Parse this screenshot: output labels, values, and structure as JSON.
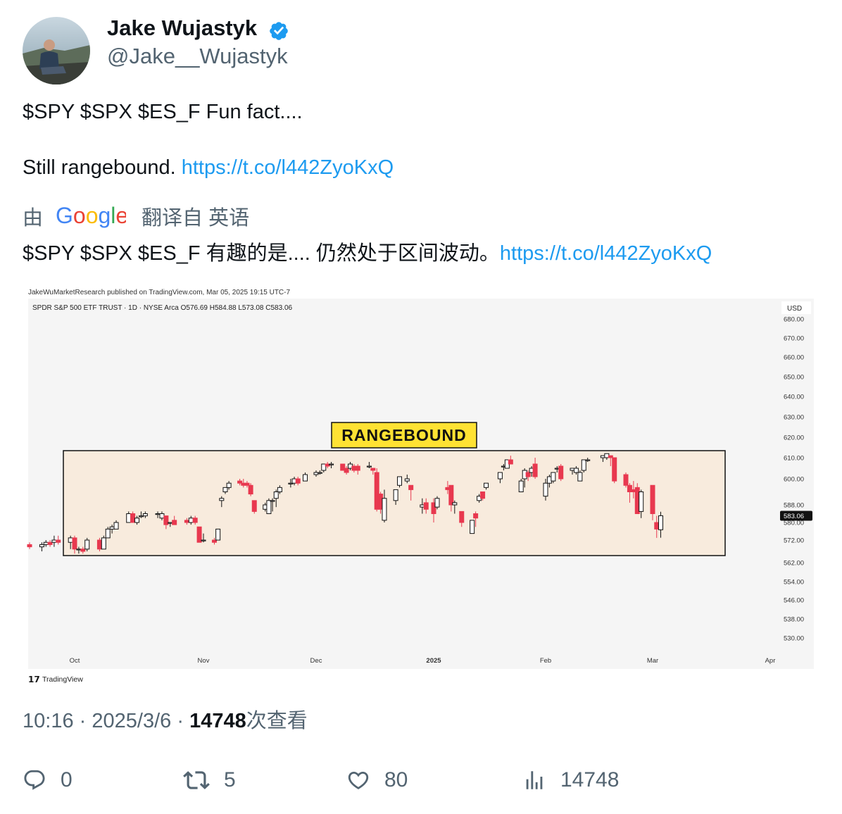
{
  "author": {
    "name": "Jake Wujastyk",
    "handle": "@Jake__Wujastyk"
  },
  "tweet": {
    "line1": "$SPY $SPX $ES_F Fun fact....",
    "line2_text": "Still rangebound. ",
    "link": "https://t.co/l442ZyoKxQ",
    "translated_by_prefix": "由",
    "translated_by_suffix": "翻译自 英语",
    "translation_text": "$SPY $SPX $ES_F 有趣的是.... 仍然处于区间波动。",
    "translation_link": "https://t.co/l442ZyoKxQ"
  },
  "chart": {
    "publisher_line": "JakeWuMarketResearch published on TradingView.com, Mar 05, 2025 19:15 UTC-7",
    "symbol_line": "SPDR S&P 500 ETF TRUST · 1D · NYSE Arca  O576.69  H584.88  L573.08  C583.06",
    "currency": "USD",
    "price_ticks": [
      "680.00",
      "670.00",
      "660.00",
      "650.00",
      "640.00",
      "630.00",
      "620.00",
      "610.00",
      "600.00",
      "588.00",
      "580.00",
      "572.00",
      "562.00",
      "554.00",
      "546.00",
      "538.00",
      "530.00"
    ],
    "last_price": "583.06",
    "month_labels": [
      "Oct",
      "Nov",
      "Dec",
      "2025",
      "Feb",
      "Mar",
      "Apr"
    ],
    "annotation": "RANGEBOUND",
    "watermark": "TradingView",
    "up_color": "#111111",
    "down_color": "#e8384f",
    "box_fill": "#f8ebdd",
    "label_fill": "#ffe233",
    "candles": [
      {
        "d": "2024-09-20",
        "o": 570,
        "h": 571,
        "l": 568,
        "c": 569
      },
      {
        "d": "2024-09-23",
        "o": 569,
        "h": 571,
        "l": 567,
        "c": 570
      },
      {
        "d": "2024-09-24",
        "o": 570,
        "h": 572,
        "l": 569,
        "c": 571
      },
      {
        "d": "2024-09-25",
        "o": 571,
        "h": 572,
        "l": 569,
        "c": 570
      },
      {
        "d": "2024-09-26",
        "o": 571,
        "h": 574,
        "l": 569,
        "c": 572
      },
      {
        "d": "2024-09-27",
        "o": 572,
        "h": 574,
        "l": 570,
        "c": 571
      },
      {
        "d": "2024-09-30",
        "o": 571,
        "h": 574,
        "l": 568,
        "c": 573
      },
      {
        "d": "2024-10-01",
        "o": 573,
        "h": 574,
        "l": 566,
        "c": 568
      },
      {
        "d": "2024-10-02",
        "o": 568,
        "h": 569,
        "l": 566,
        "c": 568
      },
      {
        "d": "2024-10-03",
        "o": 568,
        "h": 569,
        "l": 566,
        "c": 567
      },
      {
        "d": "2024-10-04",
        "o": 568,
        "h": 573,
        "l": 567,
        "c": 572
      },
      {
        "d": "2024-10-07",
        "o": 572,
        "h": 573,
        "l": 567,
        "c": 568
      },
      {
        "d": "2024-10-08",
        "o": 568,
        "h": 574,
        "l": 568,
        "c": 573
      },
      {
        "d": "2024-10-09",
        "o": 573,
        "h": 578,
        "l": 573,
        "c": 577
      },
      {
        "d": "2024-10-10",
        "o": 577,
        "h": 579,
        "l": 575,
        "c": 578
      },
      {
        "d": "2024-10-11",
        "o": 577,
        "h": 581,
        "l": 577,
        "c": 580
      },
      {
        "d": "2024-10-14",
        "o": 580,
        "h": 585,
        "l": 580,
        "c": 584
      },
      {
        "d": "2024-10-15",
        "o": 584,
        "h": 585,
        "l": 580,
        "c": 580
      },
      {
        "d": "2024-10-16",
        "o": 580,
        "h": 583,
        "l": 579,
        "c": 582
      },
      {
        "d": "2024-10-17",
        "o": 583,
        "h": 585,
        "l": 582,
        "c": 583
      },
      {
        "d": "2024-10-18",
        "o": 583,
        "h": 585,
        "l": 582,
        "c": 584
      },
      {
        "d": "2024-10-21",
        "o": 584,
        "h": 585,
        "l": 582,
        "c": 584
      },
      {
        "d": "2024-10-22",
        "o": 582,
        "h": 585,
        "l": 581,
        "c": 584
      },
      {
        "d": "2024-10-23",
        "o": 583,
        "h": 583,
        "l": 577,
        "c": 579
      },
      {
        "d": "2024-10-24",
        "o": 580,
        "h": 580,
        "l": 578,
        "c": 580
      },
      {
        "d": "2024-10-25",
        "o": 581,
        "h": 583,
        "l": 579,
        "c": 579
      },
      {
        "d": "2024-10-28",
        "o": 581,
        "h": 582,
        "l": 579,
        "c": 580
      },
      {
        "d": "2024-10-29",
        "o": 580,
        "h": 583,
        "l": 579,
        "c": 582
      },
      {
        "d": "2024-10-30",
        "o": 582,
        "h": 583,
        "l": 579,
        "c": 580
      },
      {
        "d": "2024-10-31",
        "o": 578,
        "h": 578,
        "l": 571,
        "c": 571
      },
      {
        "d": "2024-11-01",
        "o": 572,
        "h": 575,
        "l": 571,
        "c": 572
      },
      {
        "d": "2024-11-04",
        "o": 572,
        "h": 573,
        "l": 570,
        "c": 571
      },
      {
        "d": "2024-11-05",
        "o": 572,
        "h": 577,
        "l": 572,
        "c": 577
      },
      {
        "d": "2024-11-06",
        "o": 590,
        "h": 592,
        "l": 587,
        "c": 591
      },
      {
        "d": "2024-11-07",
        "o": 594,
        "h": 596,
        "l": 593,
        "c": 596
      },
      {
        "d": "2024-11-08",
        "o": 596,
        "h": 599,
        "l": 595,
        "c": 598
      },
      {
        "d": "2024-11-11",
        "o": 599,
        "h": 600,
        "l": 597,
        "c": 598
      },
      {
        "d": "2024-11-12",
        "o": 598,
        "h": 600,
        "l": 596,
        "c": 597
      },
      {
        "d": "2024-11-13",
        "o": 598,
        "h": 599,
        "l": 596,
        "c": 597
      },
      {
        "d": "2024-11-14",
        "o": 597,
        "h": 598,
        "l": 592,
        "c": 593
      },
      {
        "d": "2024-11-15",
        "o": 590,
        "h": 590,
        "l": 584,
        "c": 585
      },
      {
        "d": "2024-11-18",
        "o": 586,
        "h": 589,
        "l": 585,
        "c": 588
      },
      {
        "d": "2024-11-19",
        "o": 584,
        "h": 591,
        "l": 584,
        "c": 590
      },
      {
        "d": "2024-11-20",
        "o": 590,
        "h": 591,
        "l": 585,
        "c": 590
      },
      {
        "d": "2024-11-21",
        "o": 591,
        "h": 595,
        "l": 587,
        "c": 594
      },
      {
        "d": "2024-11-22",
        "o": 594,
        "h": 597,
        "l": 593,
        "c": 596
      },
      {
        "d": "2024-11-25",
        "o": 598,
        "h": 600,
        "l": 596,
        "c": 598
      },
      {
        "d": "2024-11-26",
        "o": 598,
        "h": 601,
        "l": 597,
        "c": 600
      },
      {
        "d": "2024-11-27",
        "o": 600,
        "h": 601,
        "l": 597,
        "c": 598
      },
      {
        "d": "2024-11-29",
        "o": 599,
        "h": 603,
        "l": 599,
        "c": 602
      },
      {
        "d": "2024-12-02",
        "o": 602,
        "h": 604,
        "l": 601,
        "c": 603
      },
      {
        "d": "2024-12-03",
        "o": 603,
        "h": 604,
        "l": 602,
        "c": 603
      },
      {
        "d": "2024-12-04",
        "o": 604,
        "h": 607,
        "l": 603,
        "c": 607
      },
      {
        "d": "2024-12-05",
        "o": 607,
        "h": 608,
        "l": 605,
        "c": 606
      },
      {
        "d": "2024-12-06",
        "o": 607,
        "h": 608,
        "l": 605,
        "c": 607
      },
      {
        "d": "2024-12-09",
        "o": 607,
        "h": 607,
        "l": 604,
        "c": 604
      },
      {
        "d": "2024-12-10",
        "o": 605,
        "h": 606,
        "l": 602,
        "c": 603
      },
      {
        "d": "2024-12-11",
        "o": 605,
        "h": 608,
        "l": 604,
        "c": 607
      },
      {
        "d": "2024-12-12",
        "o": 606,
        "h": 607,
        "l": 603,
        "c": 604
      },
      {
        "d": "2024-12-13",
        "o": 606,
        "h": 607,
        "l": 602,
        "c": 604
      },
      {
        "d": "2024-12-16",
        "o": 606,
        "h": 608,
        "l": 605,
        "c": 606
      },
      {
        "d": "2024-12-17",
        "o": 605,
        "h": 605,
        "l": 602,
        "c": 604
      },
      {
        "d": "2024-12-18",
        "o": 603,
        "h": 605,
        "l": 585,
        "c": 586
      },
      {
        "d": "2024-12-19",
        "o": 593,
        "h": 594,
        "l": 584,
        "c": 586
      },
      {
        "d": "2024-12-20",
        "o": 581,
        "h": 595,
        "l": 580,
        "c": 591
      },
      {
        "d": "2024-12-23",
        "o": 590,
        "h": 595,
        "l": 588,
        "c": 595
      },
      {
        "d": "2024-12-24",
        "o": 597,
        "h": 601,
        "l": 596,
        "c": 601
      },
      {
        "d": "2024-12-26",
        "o": 599,
        "h": 602,
        "l": 598,
        "c": 600
      },
      {
        "d": "2024-12-27",
        "o": 597,
        "h": 597,
        "l": 590,
        "c": 595
      },
      {
        "d": "2024-12-30",
        "o": 587,
        "h": 591,
        "l": 584,
        "c": 588
      },
      {
        "d": "2024-12-31",
        "o": 589,
        "h": 591,
        "l": 584,
        "c": 586
      },
      {
        "d": "2025-01-02",
        "o": 589,
        "h": 591,
        "l": 580,
        "c": 584
      },
      {
        "d": "2025-01-03",
        "o": 587,
        "h": 592,
        "l": 586,
        "c": 591
      },
      {
        "d": "2025-01-06",
        "o": 596,
        "h": 599,
        "l": 593,
        "c": 595
      },
      {
        "d": "2025-01-07",
        "o": 597,
        "h": 597,
        "l": 585,
        "c": 588
      },
      {
        "d": "2025-01-08",
        "o": 588,
        "h": 590,
        "l": 584,
        "c": 589
      },
      {
        "d": "2025-01-10",
        "o": 585,
        "h": 585,
        "l": 578,
        "c": 580
      },
      {
        "d": "2025-01-13",
        "o": 575,
        "h": 581,
        "l": 575,
        "c": 581
      },
      {
        "d": "2025-01-14",
        "o": 584,
        "h": 585,
        "l": 578,
        "c": 582
      },
      {
        "d": "2025-01-15",
        "o": 590,
        "h": 593,
        "l": 589,
        "c": 592
      },
      {
        "d": "2025-01-16",
        "o": 594,
        "h": 594,
        "l": 590,
        "c": 591
      },
      {
        "d": "2025-01-17",
        "o": 596,
        "h": 598,
        "l": 595,
        "c": 598
      },
      {
        "d": "2025-01-21",
        "o": 600,
        "h": 603,
        "l": 598,
        "c": 603
      },
      {
        "d": "2025-01-22",
        "o": 606,
        "h": 607,
        "l": 604,
        "c": 606
      },
      {
        "d": "2025-01-23",
        "o": 605,
        "h": 609,
        "l": 605,
        "c": 609
      },
      {
        "d": "2025-01-24",
        "o": 609,
        "h": 611,
        "l": 607,
        "c": 607
      },
      {
        "d": "2025-01-27",
        "o": 594,
        "h": 600,
        "l": 594,
        "c": 599
      },
      {
        "d": "2025-01-28",
        "o": 600,
        "h": 605,
        "l": 596,
        "c": 604
      },
      {
        "d": "2025-01-29",
        "o": 603,
        "h": 604,
        "l": 599,
        "c": 601
      },
      {
        "d": "2025-01-30",
        "o": 603,
        "h": 606,
        "l": 601,
        "c": 605
      },
      {
        "d": "2025-01-31",
        "o": 607,
        "h": 610,
        "l": 600,
        "c": 601
      },
      {
        "d": "2025-02-03",
        "o": 592,
        "h": 600,
        "l": 590,
        "c": 598
      },
      {
        "d": "2025-02-04",
        "o": 598,
        "h": 602,
        "l": 596,
        "c": 601
      },
      {
        "d": "2025-02-05",
        "o": 599,
        "h": 603,
        "l": 598,
        "c": 603
      },
      {
        "d": "2025-02-06",
        "o": 605,
        "h": 606,
        "l": 603,
        "c": 605
      },
      {
        "d": "2025-02-07",
        "o": 606,
        "h": 607,
        "l": 599,
        "c": 600
      },
      {
        "d": "2025-02-10",
        "o": 604,
        "h": 605,
        "l": 602,
        "c": 605
      },
      {
        "d": "2025-02-11",
        "o": 603,
        "h": 606,
        "l": 602,
        "c": 605
      },
      {
        "d": "2025-02-12",
        "o": 599,
        "h": 604,
        "l": 599,
        "c": 603
      },
      {
        "d": "2025-02-13",
        "o": 604,
        "h": 609,
        "l": 603,
        "c": 609
      },
      {
        "d": "2025-02-14",
        "o": 609,
        "h": 610,
        "l": 608,
        "c": 609
      },
      {
        "d": "2025-02-18",
        "o": 610,
        "h": 611,
        "l": 608,
        "c": 611
      },
      {
        "d": "2025-02-19",
        "o": 610,
        "h": 612,
        "l": 609,
        "c": 612
      },
      {
        "d": "2025-02-20",
        "o": 611,
        "h": 611,
        "l": 606,
        "c": 610
      },
      {
        "d": "2025-02-21",
        "o": 610,
        "h": 610,
        "l": 598,
        "c": 599
      },
      {
        "d": "2025-02-24",
        "o": 602,
        "h": 603,
        "l": 596,
        "c": 597
      },
      {
        "d": "2025-02-25",
        "o": 597,
        "h": 598,
        "l": 589,
        "c": 594
      },
      {
        "d": "2025-02-26",
        "o": 595,
        "h": 599,
        "l": 591,
        "c": 594
      },
      {
        "d": "2025-02-27",
        "o": 596,
        "h": 598,
        "l": 584,
        "c": 584
      },
      {
        "d": "2025-02-28",
        "o": 585,
        "h": 595,
        "l": 582,
        "c": 594
      },
      {
        "d": "2025-03-03",
        "o": 597,
        "h": 597,
        "l": 581,
        "c": 584
      },
      {
        "d": "2025-03-04",
        "o": 580,
        "h": 583,
        "l": 573,
        "c": 577
      },
      {
        "d": "2025-03-05",
        "o": 576.69,
        "h": 584.88,
        "l": 573.08,
        "c": 583.06
      }
    ]
  },
  "meta": {
    "time": "10:16",
    "date": "2025/3/6",
    "views": "14748",
    "views_suffix": "次查看",
    "separator": "·"
  },
  "actions": {
    "replies": "0",
    "reposts": "5",
    "likes": "80",
    "views": "14748"
  }
}
